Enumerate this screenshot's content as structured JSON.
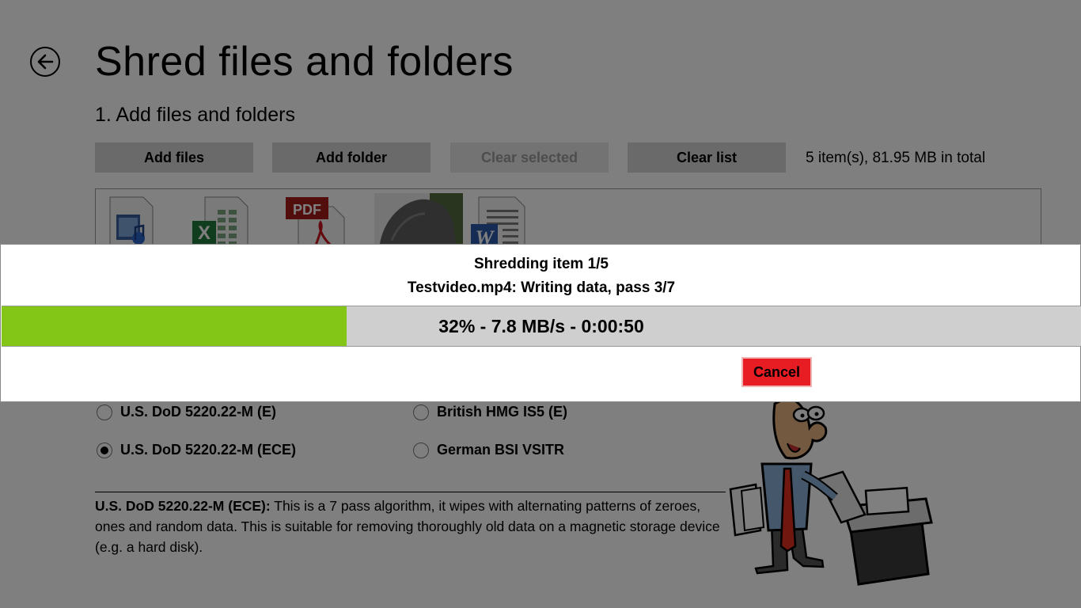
{
  "page": {
    "title": "Shred files and folders",
    "section1_title": "1. Add files and folders"
  },
  "toolbar": {
    "add_files": "Add files",
    "add_folder": "Add folder",
    "clear_selected": "Clear selected",
    "clear_list": "Clear list",
    "totals": "5 item(s), 81.95 MB in total"
  },
  "files": [
    {
      "icon": "video-file-icon"
    },
    {
      "icon": "excel-file-icon"
    },
    {
      "icon": "pdf-file-icon",
      "badge": "PDF"
    },
    {
      "icon": "image-file-icon"
    },
    {
      "icon": "word-file-icon",
      "letter": "W"
    }
  ],
  "methods": [
    {
      "label": "U.S. DoD 5220.22-M (E)",
      "selected": false
    },
    {
      "label": "U.S. DoD 5220.22-M (ECE)",
      "selected": true
    },
    {
      "label": "British HMG IS5 (E)",
      "selected": false
    },
    {
      "label": "German BSI VSITR",
      "selected": false
    }
  ],
  "description": {
    "heading": "U.S. DoD 5220.22-M (ECE):",
    "text": " This is a 7 pass algorithm, it wipes with alternating patterns of zeroes, ones and random data. This is suitable for removing thoroughly old data on a magnetic storage device (e.g. a hard disk)."
  },
  "dialog": {
    "line1": "Shredding item 1/5",
    "line2": "Testvideo.mp4: Writing data, pass 3/7",
    "progress_percent": 32,
    "progress_text": "32% - 7.8 MB/s - 0:00:50",
    "cancel": "Cancel"
  },
  "colors": {
    "progress_fill": "#84c618",
    "progress_track": "#cfcfcf",
    "cancel_bg": "#e81c23",
    "overlay": "rgba(0,0,0,0.5)"
  }
}
